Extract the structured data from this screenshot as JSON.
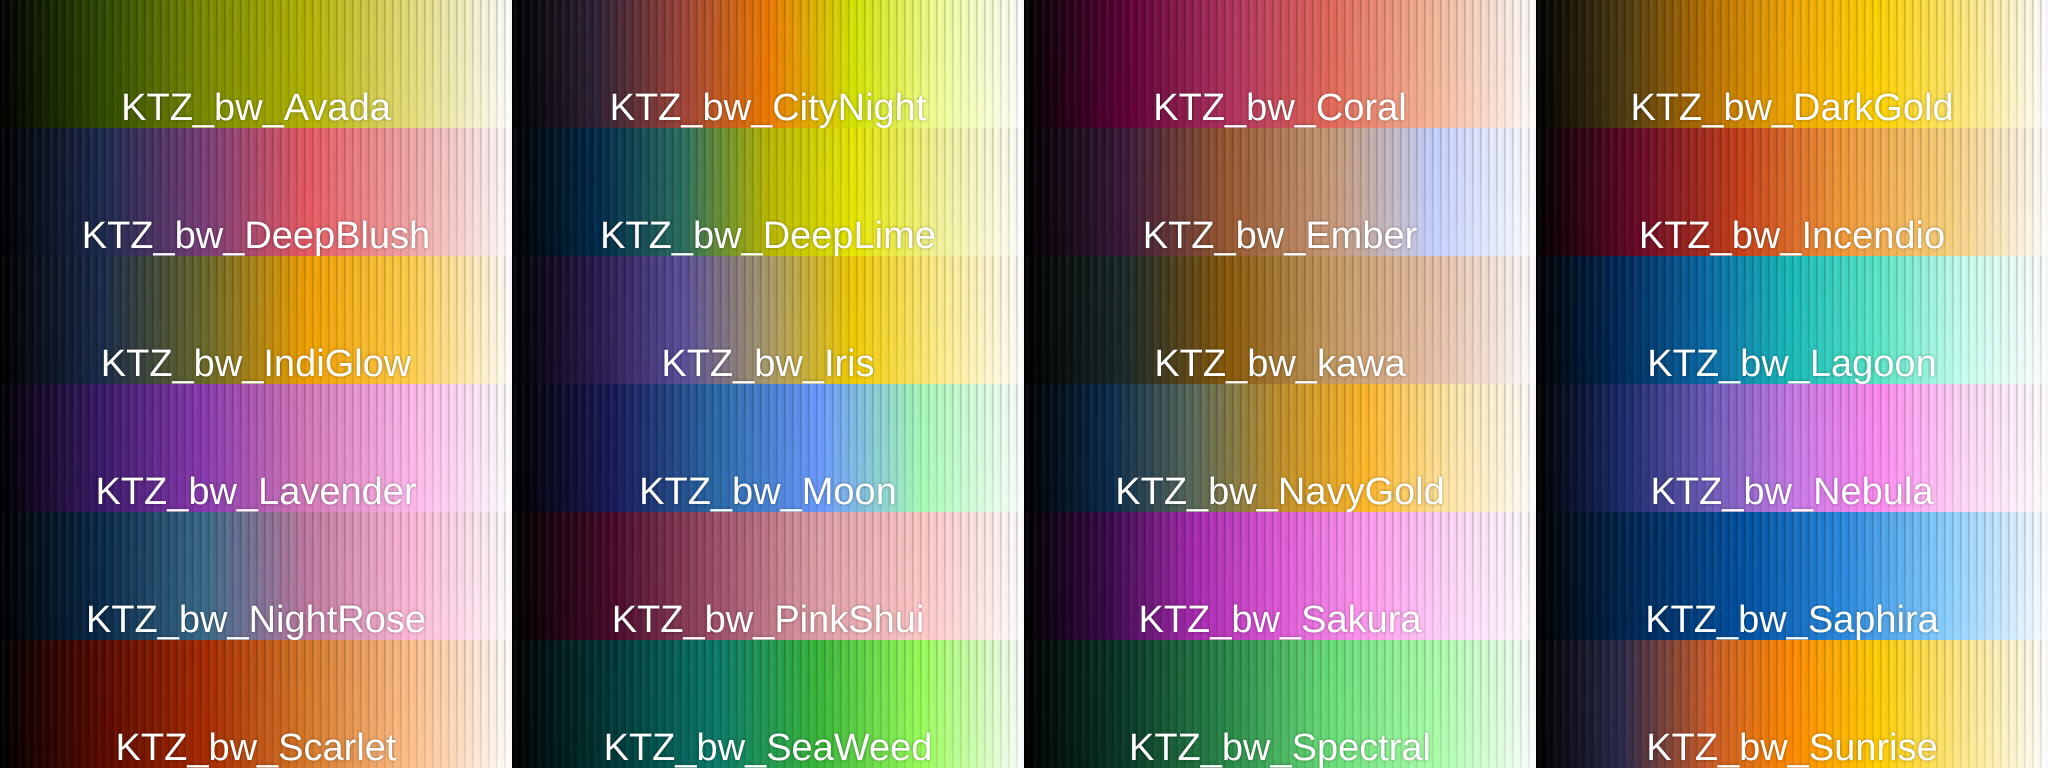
{
  "colormaps": [
    {
      "label": "KTZ_bw_Avada",
      "colors": [
        "#000000",
        "#2f4a00",
        "#7a8a00",
        "#b3b300",
        "#e6de7a",
        "#ffffff"
      ]
    },
    {
      "label": "KTZ_bw_CityNight",
      "colors": [
        "#000000",
        "#2e2236",
        "#a0443a",
        "#ef7a00",
        "#d4e600",
        "#f2ff9a",
        "#ffffff"
      ]
    },
    {
      "label": "KTZ_bw_Coral",
      "colors": [
        "#000000",
        "#5e0038",
        "#b0325e",
        "#e46a5a",
        "#f6b89a",
        "#ffffff"
      ]
    },
    {
      "label": "KTZ_bw_DarkGold",
      "colors": [
        "#000000",
        "#4a3a12",
        "#b87000",
        "#f2a800",
        "#ffd400",
        "#ffe97a",
        "#ffffff"
      ]
    },
    {
      "label": "KTZ_bw_DeepBlush",
      "colors": [
        "#000000",
        "#1c2a4e",
        "#7a3e78",
        "#e85a62",
        "#f2a6a6",
        "#ffffff"
      ]
    },
    {
      "label": "KTZ_bw_DeepLime",
      "colors": [
        "#000000",
        "#002a4a",
        "#2a6e60",
        "#b8b800",
        "#e8e800",
        "#f4f49a",
        "#ffffff"
      ]
    },
    {
      "label": "KTZ_bw_Ember",
      "colors": [
        "#000000",
        "#3a1a3a",
        "#9a5a32",
        "#c89a78",
        "#c6d2ff",
        "#ffffff"
      ]
    },
    {
      "label": "KTZ_bw_Incendio",
      "colors": [
        "#000000",
        "#6a0a28",
        "#c8401a",
        "#f29a3a",
        "#f8d07a",
        "#ffffff"
      ]
    },
    {
      "label": "KTZ_bw_IndiGlow",
      "colors": [
        "#000000",
        "#1a2a4a",
        "#6a6a2a",
        "#f2a000",
        "#ffce4a",
        "#ffffff"
      ]
    },
    {
      "label": "KTZ_bw_Iris",
      "colors": [
        "#000000",
        "#2a1a4e",
        "#5a4e9a",
        "#a89a6a",
        "#f2cc00",
        "#ffee8a",
        "#ffffff"
      ]
    },
    {
      "label": "KTZ_bw_kawa",
      "colors": [
        "#000000",
        "#1a2a2a",
        "#8a5a0a",
        "#c49a62",
        "#e8c0a8",
        "#ffffff"
      ]
    },
    {
      "label": "KTZ_bw_Lagoon",
      "colors": [
        "#000000",
        "#002a5a",
        "#0a6aa8",
        "#1abcba",
        "#5ae8c8",
        "#c8fff0",
        "#ffffff"
      ]
    },
    {
      "label": "KTZ_bw_Lavender",
      "colors": [
        "#000000",
        "#3a1a6a",
        "#8a3ab0",
        "#d67ab8",
        "#ffb8ec",
        "#ffffff"
      ]
    },
    {
      "label": "KTZ_bw_Moon",
      "colors": [
        "#000000",
        "#1a1a5a",
        "#2a6aa8",
        "#6a9aff",
        "#a8fcb8",
        "#ffffff"
      ]
    },
    {
      "label": "KTZ_bw_NavyGold",
      "colors": [
        "#000000",
        "#0a2a4a",
        "#5a6a5a",
        "#c0902a",
        "#ffb82a",
        "#ffe8a8",
        "#ffffff"
      ]
    },
    {
      "label": "KTZ_bw_Nebula",
      "colors": [
        "#000000",
        "#1a2a6a",
        "#6a5ab8",
        "#c87ae8",
        "#ff8af2",
        "#ffd8f8",
        "#ffffff"
      ]
    },
    {
      "label": "KTZ_bw_NightRose",
      "colors": [
        "#000000",
        "#0a2a4a",
        "#3a6a8a",
        "#c07aa0",
        "#ffb8d8",
        "#ffffff"
      ]
    },
    {
      "label": "KTZ_bw_PinkShui",
      "colors": [
        "#000000",
        "#4a0a2a",
        "#a0506a",
        "#e0a0a8",
        "#ffc8c8",
        "#ffffff"
      ]
    },
    {
      "label": "KTZ_bw_Sakura",
      "colors": [
        "#000000",
        "#3a0a4a",
        "#a82ab0",
        "#e05ad8",
        "#ff9af0",
        "#ffd8fa",
        "#ffffff"
      ]
    },
    {
      "label": "KTZ_bw_Saphira",
      "colors": [
        "#000000",
        "#002a5a",
        "#0050a0",
        "#2a8ae0",
        "#8ad0ff",
        "#ffffff"
      ]
    },
    {
      "label": "KTZ_bw_Scarlet",
      "colors": [
        "#000000",
        "#5a0a00",
        "#a82a00",
        "#d87a2a",
        "#ffc08a",
        "#ffffff"
      ]
    },
    {
      "label": "KTZ_bw_SeaWeed",
      "colors": [
        "#000000",
        "#003a3a",
        "#0a7a6a",
        "#3ab83a",
        "#9aff5a",
        "#ffffff"
      ]
    },
    {
      "label": "KTZ_bw_Spectral",
      "colors": [
        "#000000",
        "#0a3a2a",
        "#2a8a4a",
        "#6ae07a",
        "#aaffaa",
        "#ffffff"
      ]
    },
    {
      "label": "KTZ_bw_Sunrise",
      "colors": [
        "#000000",
        "#2a2a4a",
        "#c85a2a",
        "#ff8a00",
        "#ffd000",
        "#ffea8a",
        "#ffffff"
      ]
    }
  ]
}
